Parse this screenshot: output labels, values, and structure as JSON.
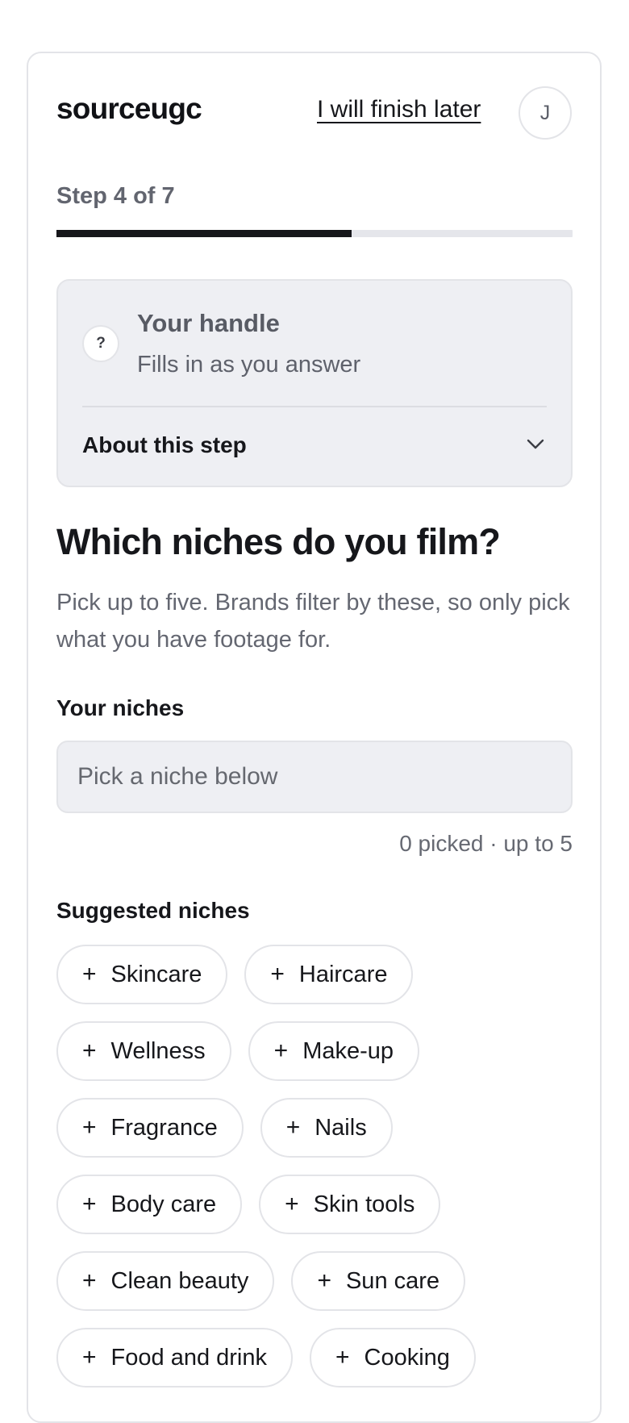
{
  "header": {
    "brand": "sourceugc",
    "finish_later": "I will finish later",
    "avatar_initial": "J"
  },
  "progress": {
    "label": "Step 4 of 7",
    "current_step": 4,
    "total_steps": 7
  },
  "handle_panel": {
    "icon_glyph": "?",
    "title": "Your handle",
    "subtitle": "Fills in as you answer",
    "about_label": "About this step"
  },
  "question": {
    "heading": "Which niches do you film?",
    "description": "Pick up to five. Brands filter by these, so only pick what you have footage for."
  },
  "niches_field": {
    "label": "Your niches",
    "value": "",
    "placeholder": "Pick a niche below",
    "count_note": "0 picked · up to 5"
  },
  "suggested": {
    "label": "Suggested niches",
    "chip_icon": "+",
    "chips": [
      "Skincare",
      "Haircare",
      "Wellness",
      "Make-up",
      "Fragrance",
      "Nails",
      "Body care",
      "Skin tools",
      "Clean beauty",
      "Sun care",
      "Food and drink",
      "Cooking"
    ]
  }
}
